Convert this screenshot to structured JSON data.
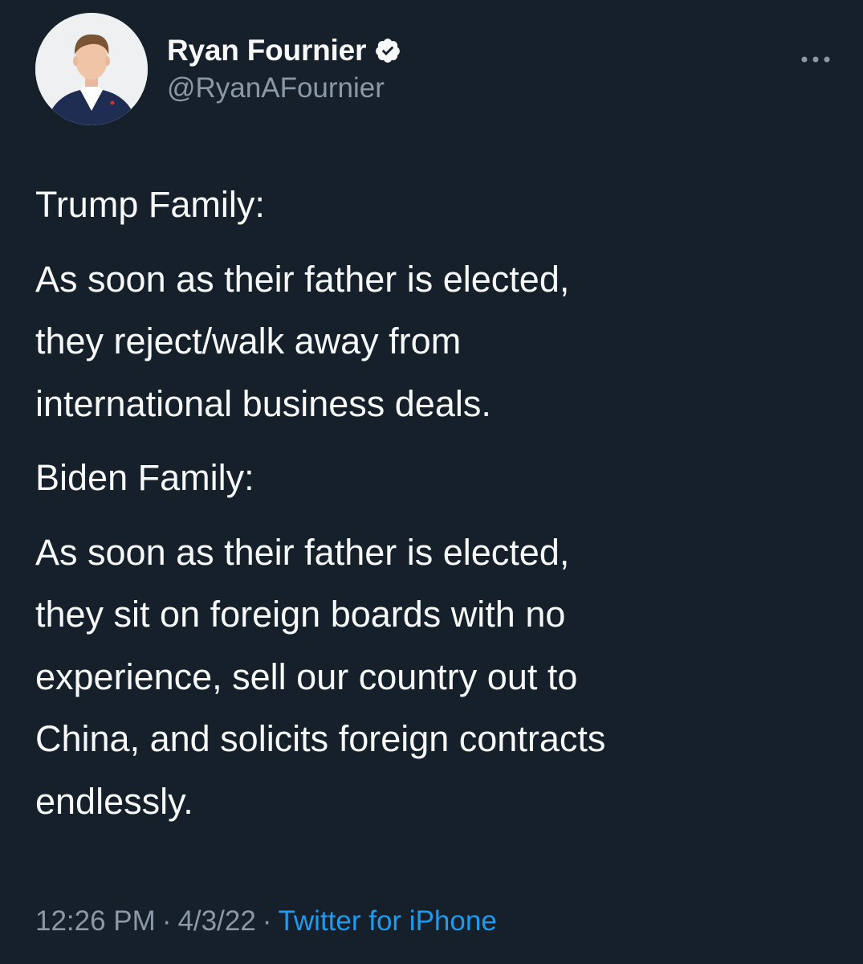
{
  "author": {
    "display_name": "Ryan Fournier",
    "handle": "@RyanAFournier",
    "verified_icon": "verified-badge-icon"
  },
  "tweet": {
    "paragraphs": [
      "Trump Family:",
      "As soon as their father is elected,\nthey reject/walk away from\ninternational business deals.",
      "Biden Family:",
      "As soon as their father is elected,\nthey sit on foreign boards with no\nexperience, sell our country out to\nChina, and solicits foreign contracts\nendlessly."
    ]
  },
  "meta": {
    "time": "12:26 PM",
    "date": "4/3/22",
    "separator": "·",
    "source": "Twitter for iPhone"
  },
  "colors": {
    "background": "#15202b",
    "text_primary": "#f7f9f9",
    "text_secondary": "#8b98a5",
    "link": "#1d9bf0"
  }
}
